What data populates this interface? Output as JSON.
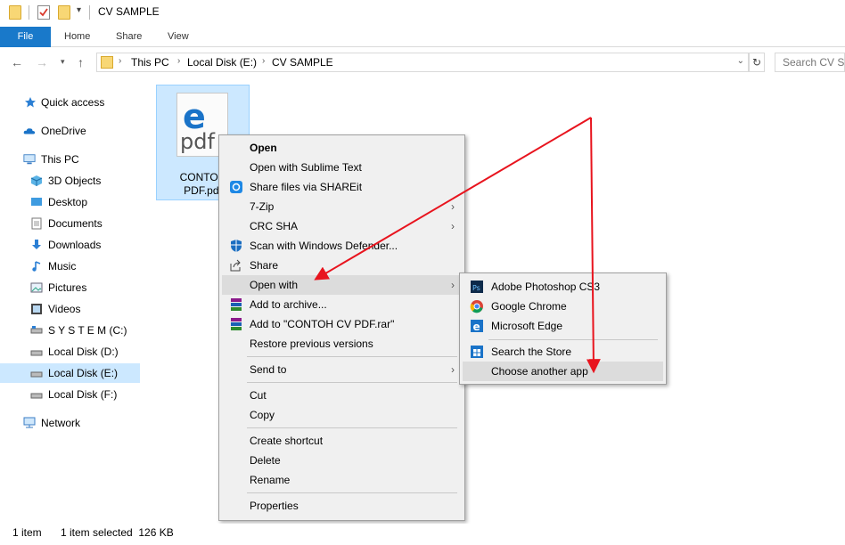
{
  "window": {
    "title": "CV SAMPLE"
  },
  "ribbon": {
    "tabs": [
      "File",
      "Home",
      "Share",
      "View"
    ]
  },
  "address": {
    "crumbs": [
      "This PC",
      "Local Disk (E:)",
      "CV SAMPLE"
    ],
    "search_placeholder": "Search CV SA"
  },
  "nav": {
    "items": [
      {
        "label": "Quick access",
        "icon": "star-icon"
      },
      {
        "label": "OneDrive",
        "icon": "cloud-icon"
      },
      {
        "label": "This PC",
        "icon": "computer-icon"
      },
      {
        "label": "3D Objects",
        "icon": "cube-icon"
      },
      {
        "label": "Desktop",
        "icon": "desktop-icon"
      },
      {
        "label": "Documents",
        "icon": "documents-icon"
      },
      {
        "label": "Downloads",
        "icon": "download-icon"
      },
      {
        "label": "Music",
        "icon": "music-icon"
      },
      {
        "label": "Pictures",
        "icon": "pictures-icon"
      },
      {
        "label": "Videos",
        "icon": "videos-icon"
      },
      {
        "label": "S Y S T E M (C:)",
        "icon": "drive-icon"
      },
      {
        "label": "Local Disk (D:)",
        "icon": "drive-icon"
      },
      {
        "label": "Local Disk (E:)",
        "icon": "drive-icon",
        "selected": true
      },
      {
        "label": "Local Disk (F:)",
        "icon": "drive-icon"
      },
      {
        "label": "Network",
        "icon": "network-icon"
      }
    ]
  },
  "file": {
    "name_line1": "CONTOH",
    "name_line2": "PDF.pdf",
    "icon_letter": "e",
    "icon_text": "pdf"
  },
  "context_menu": {
    "items": [
      {
        "label": "Open",
        "bold": true
      },
      {
        "label": "Open with Sublime Text"
      },
      {
        "label": "Share files via SHAREit",
        "icon": "shareit-icon"
      },
      {
        "label": "7-Zip",
        "submenu": true
      },
      {
        "label": "CRC SHA",
        "submenu": true
      },
      {
        "label": "Scan with Windows Defender...",
        "icon": "defender-icon"
      },
      {
        "label": "Share",
        "icon": "share-icon"
      },
      {
        "label": "Open with",
        "submenu": true,
        "highlighted": true
      },
      {
        "label": "Add to archive...",
        "icon": "winrar-icon"
      },
      {
        "label": "Add to \"CONTOH CV PDF.rar\"",
        "icon": "winrar-icon"
      },
      {
        "label": "Restore previous versions"
      },
      {
        "label": "Send to",
        "submenu": true
      },
      {
        "label": "Cut"
      },
      {
        "label": "Copy"
      },
      {
        "label": "Create shortcut"
      },
      {
        "label": "Delete"
      },
      {
        "label": "Rename"
      },
      {
        "label": "Properties"
      }
    ]
  },
  "open_with_menu": {
    "items": [
      {
        "label": "Adobe Photoshop CS3",
        "icon": "photoshop-icon"
      },
      {
        "label": "Google Chrome",
        "icon": "chrome-icon"
      },
      {
        "label": "Microsoft Edge",
        "icon": "edge-icon"
      },
      {
        "label": "Search the Store",
        "icon": "store-icon"
      },
      {
        "label": "Choose another app",
        "highlighted": true
      }
    ]
  },
  "status": {
    "count": "1 item",
    "selected": "1 item selected  126 KB"
  },
  "colors": {
    "accent": "#1979ca",
    "selection": "#cce8ff",
    "arrow": "#e8141e"
  }
}
